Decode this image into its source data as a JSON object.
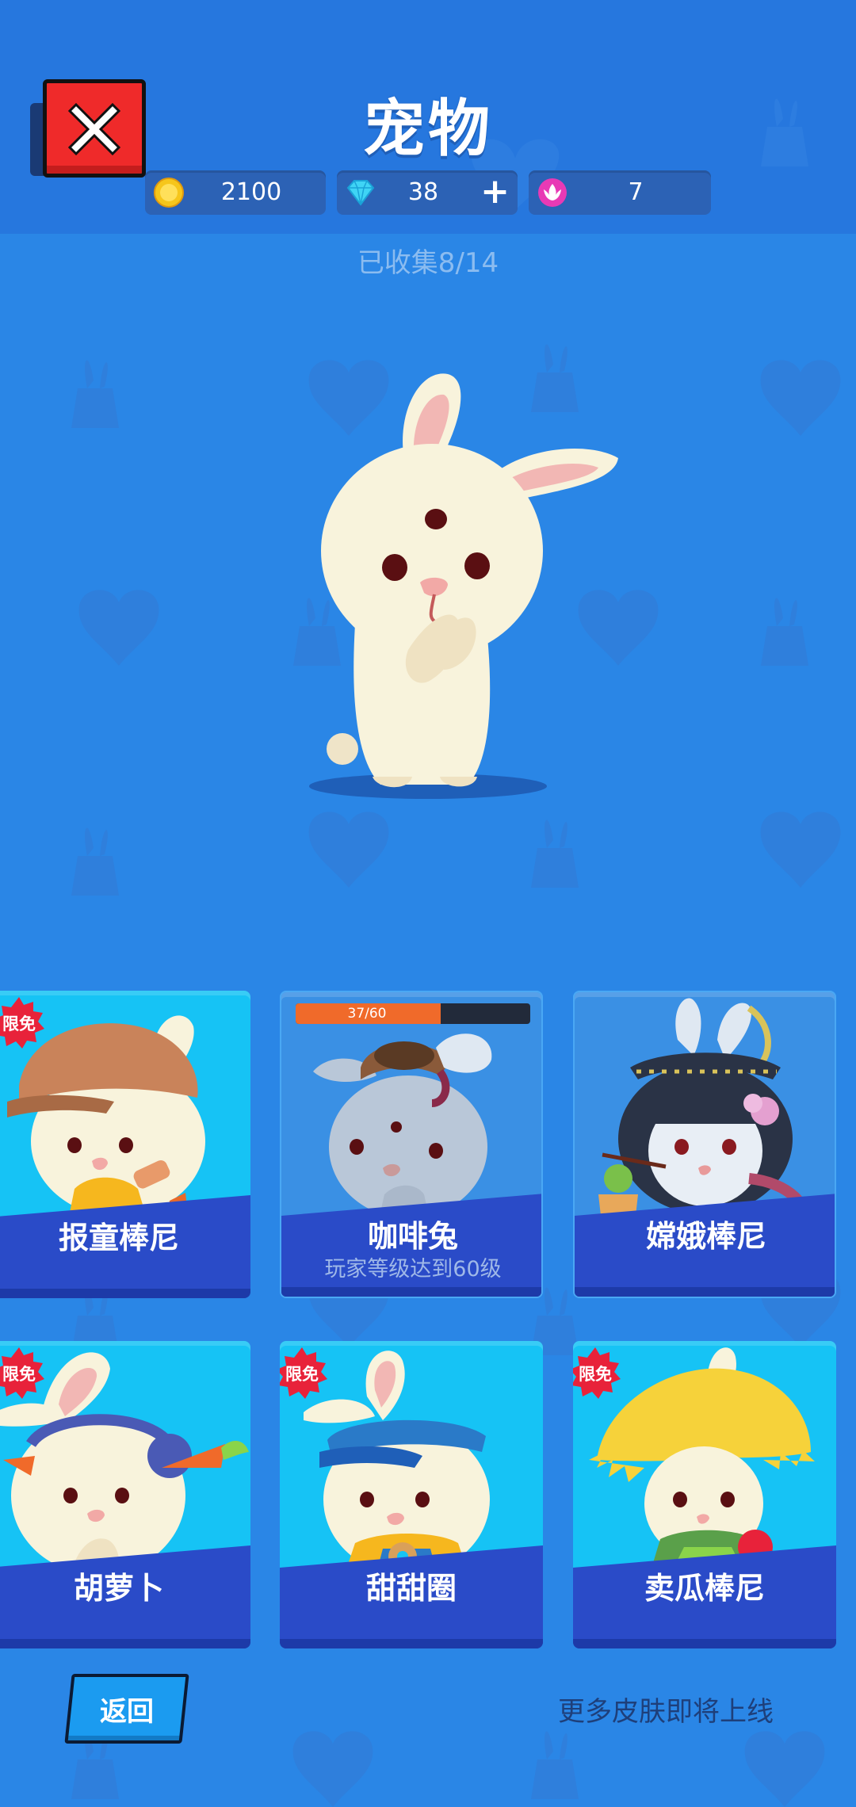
{
  "header": {
    "title": "宠物",
    "coins": "2100",
    "gems": "38",
    "lotus": "7"
  },
  "collected_text": "已收集8/14",
  "cards": [
    {
      "name": "报童棒尼",
      "badge": "限免",
      "sub": "",
      "locked": false
    },
    {
      "name": "咖啡兔",
      "badge": "",
      "sub": "玩家等级达到60级",
      "locked": true,
      "progress_text": "37/60",
      "progress_value": 37,
      "progress_max": 60
    },
    {
      "name": "嫦娥棒尼",
      "badge": "",
      "sub": "",
      "locked": false
    },
    {
      "name": "胡萝卜",
      "badge": "限免",
      "sub": "",
      "locked": false
    },
    {
      "name": "甜甜圈",
      "badge": "限免",
      "sub": "",
      "locked": false
    },
    {
      "name": "卖瓜棒尼",
      "badge": "限免",
      "sub": "",
      "locked": false
    }
  ],
  "footer": {
    "back_label": "返回",
    "more_text": "更多皮肤即将上线"
  },
  "colors": {
    "background": "#2a86e6",
    "header": "#2677de",
    "card": "#16c3f5",
    "banner": "#2a4bc8",
    "badge": "#e8223a",
    "close": "#ef2a2a",
    "progress": "#f06a2a"
  },
  "icons": {
    "close": "close-x-icon",
    "coin": "coin-icon",
    "gem": "diamond-icon",
    "lotus": "lotus-icon",
    "plus": "plus-icon"
  }
}
